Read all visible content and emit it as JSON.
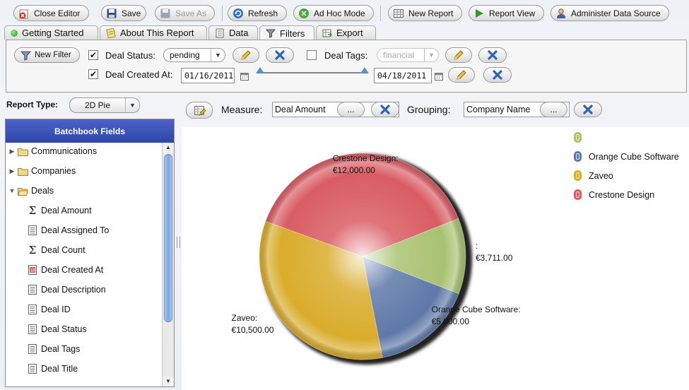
{
  "toolbar": {
    "close_editor": "Close Editor",
    "save": "Save",
    "save_as": "Save As",
    "refresh": "Refresh",
    "ad_hoc_mode": "Ad Hoc Mode",
    "new_report": "New Report",
    "report_view": "Report View",
    "administer_data_source": "Administer Data Source"
  },
  "tabs": [
    {
      "label": "Getting Started",
      "icon": "green-dot-icon"
    },
    {
      "label": "About This Report",
      "icon": "notepad-icon"
    },
    {
      "label": "Data",
      "icon": "data-sheet-icon"
    },
    {
      "label": "Filters",
      "icon": "filter-funnel-icon",
      "active": true
    },
    {
      "label": "Export",
      "icon": "export-icon"
    }
  ],
  "filters": {
    "new_filter": "New Filter",
    "deal_status_label": "Deal Status:",
    "deal_status_value": "pending",
    "deal_status_checked": true,
    "deal_tags_label": "Deal Tags:",
    "deal_tags_value": "financial",
    "deal_tags_checked": false,
    "deal_created_label": "Deal Created At:",
    "deal_created_checked": true,
    "date_from": "01/16/2011",
    "date_to": "04/18/2011"
  },
  "report_type": {
    "label": "Report Type:",
    "value": "2D Pie"
  },
  "fields_panel": {
    "title": "Batchbook Fields",
    "items": [
      {
        "label": "Communications",
        "icon": "folder-icon",
        "expander": "▶"
      },
      {
        "label": "Companies",
        "icon": "folder-icon",
        "expander": "▶"
      },
      {
        "label": "Deals",
        "icon": "folder-open-icon",
        "expander": "▼"
      },
      {
        "label": "Deal Amount",
        "icon": "sigma-icon"
      },
      {
        "label": "Deal Assigned To",
        "icon": "text-field-icon"
      },
      {
        "label": "Deal Count",
        "icon": "sigma-icon"
      },
      {
        "label": "Deal Created At",
        "icon": "calendar-field-icon"
      },
      {
        "label": "Deal Description",
        "icon": "text-field-icon"
      },
      {
        "label": "Deal ID",
        "icon": "text-field-icon"
      },
      {
        "label": "Deal Status",
        "icon": "text-field-icon"
      },
      {
        "label": "Deal Tags",
        "icon": "text-field-icon"
      },
      {
        "label": "Deal Title",
        "icon": "text-field-icon"
      }
    ]
  },
  "measure": {
    "label": "Measure:",
    "value": "Deal Amount",
    "ellipsis": "...",
    "grouping_label": "Grouping:",
    "grouping_value": "Company Name"
  },
  "colors": {
    "green": "#a9c271",
    "blue": "#5f79a8",
    "yellow": "#d9ac2c",
    "red": "#d95c63"
  },
  "chart_data": {
    "type": "pie",
    "categories": [
      "",
      "Orange Cube Software",
      "Zaveo",
      "Crestone Design"
    ],
    "values": [
      3711.0,
      5000.0,
      10500.0,
      12000.0
    ],
    "value_labels": [
      "€3,711.00",
      "€5,000.00",
      "€10,500.00",
      "€12,000.00"
    ],
    "slice_names": [
      ":",
      "Orange Cube Software:",
      "Zaveo:",
      "Crestone Design:"
    ],
    "legend_position": "top-right"
  }
}
